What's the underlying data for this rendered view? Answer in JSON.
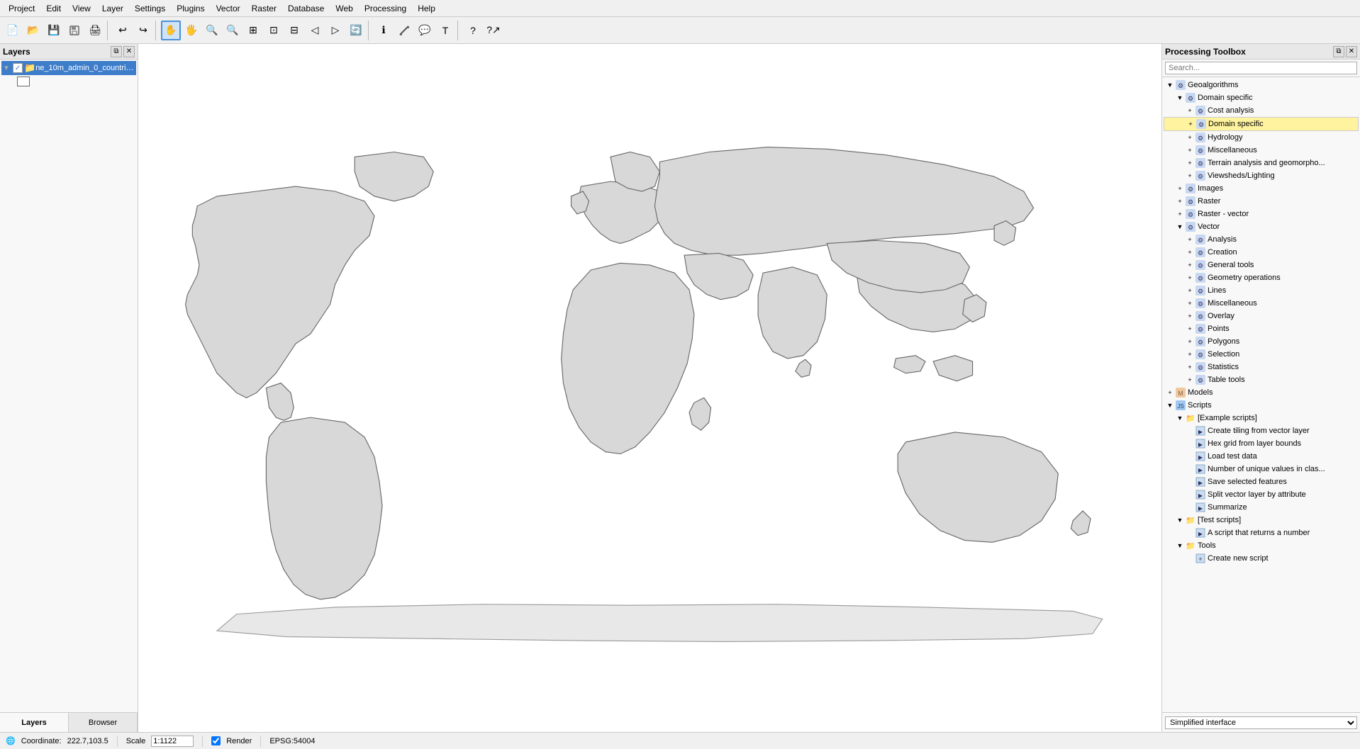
{
  "menubar": {
    "items": [
      "Project",
      "Edit",
      "View",
      "Layer",
      "Settings",
      "Plugins",
      "Vector",
      "Raster",
      "Database",
      "Web",
      "Processing",
      "Help"
    ]
  },
  "toolbar": {
    "buttons": [
      {
        "name": "new",
        "icon": "📄"
      },
      {
        "name": "open",
        "icon": "📂"
      },
      {
        "name": "save",
        "icon": "💾"
      },
      {
        "name": "save-as",
        "icon": "💾"
      },
      {
        "name": "print",
        "icon": "🖨"
      },
      {
        "name": "print-composer",
        "icon": "📋"
      },
      {
        "name": "undo",
        "icon": "↩"
      },
      {
        "name": "redo",
        "icon": "↪"
      },
      {
        "name": "pan",
        "icon": "✋"
      },
      {
        "name": "pan-map",
        "icon": "🖐"
      },
      {
        "name": "zoom-in",
        "icon": "+"
      },
      {
        "name": "zoom-out",
        "icon": "-"
      },
      {
        "name": "zoom-full",
        "icon": "⊞"
      },
      {
        "name": "zoom-layer",
        "icon": "⊡"
      },
      {
        "name": "zoom-selection",
        "icon": "⊟"
      },
      {
        "name": "zoom-last",
        "icon": "◁"
      },
      {
        "name": "zoom-next",
        "icon": "▷"
      },
      {
        "name": "refresh",
        "icon": "🔄"
      },
      {
        "name": "identify",
        "icon": "ℹ"
      },
      {
        "name": "measure",
        "icon": "📏"
      },
      {
        "name": "measure-area",
        "icon": "□"
      },
      {
        "name": "measure-angle",
        "icon": "∠"
      },
      {
        "name": "annotation",
        "icon": "💬"
      },
      {
        "name": "html-annotation",
        "icon": "⊕"
      },
      {
        "name": "svg-annotation",
        "icon": "⊗"
      },
      {
        "name": "text-annotation",
        "icon": "T"
      },
      {
        "name": "move-label",
        "icon": "A↗"
      },
      {
        "name": "help",
        "icon": "?"
      },
      {
        "name": "whats-this",
        "icon": "?↗"
      }
    ]
  },
  "left_panel": {
    "title": "Layers",
    "layers": [
      {
        "name": "ne_10m_admin_0_countric...",
        "checked": true,
        "selected": true,
        "has_sub": true
      }
    ],
    "tabs": [
      "Layers",
      "Browser"
    ]
  },
  "processing_toolbox": {
    "title": "Processing Toolbox",
    "search_placeholder": "Search...",
    "tree": {
      "geoalgorithms": {
        "label": "Geoalgorithms",
        "expanded": true,
        "children": {
          "domain_specific": {
            "label": "Domain specific",
            "expanded": true,
            "children": {
              "cost_analysis": {
                "label": "Cost analysis"
              },
              "domain_specific_tooltip": {
                "label": "Domain specific",
                "tooltip": true
              },
              "hydrology": {
                "label": "Hydrology"
              },
              "miscellaneous": {
                "label": "Miscellaneous"
              },
              "terrain_analysis": {
                "label": "Terrain analysis and geomorpho..."
              },
              "viewsheds_lighting": {
                "label": "Viewsheds/Lighting"
              }
            }
          },
          "images": {
            "label": "Images"
          },
          "raster": {
            "label": "Raster"
          },
          "raster_vector": {
            "label": "Raster - vector"
          },
          "vector": {
            "label": "Vector",
            "expanded": true,
            "children": {
              "analysis": {
                "label": "Analysis"
              },
              "creation": {
                "label": "Creation"
              },
              "general_tools": {
                "label": "General tools"
              },
              "geometry_operations": {
                "label": "Geometry operations"
              },
              "lines": {
                "label": "Lines"
              },
              "miscellaneous": {
                "label": "Miscellaneous"
              },
              "overlay": {
                "label": "Overlay"
              },
              "points": {
                "label": "Points"
              },
              "polygons": {
                "label": "Polygons"
              },
              "selection": {
                "label": "Selection"
              },
              "statistics": {
                "label": "Statistics"
              },
              "table_tools": {
                "label": "Table tools"
              }
            }
          }
        }
      },
      "models": {
        "label": "Models"
      },
      "scripts": {
        "label": "Scripts",
        "expanded": true,
        "children": {
          "example_scripts": {
            "label": "[Example scripts]",
            "expanded": true,
            "children": {
              "create_tiling": {
                "label": "Create tiling from vector layer"
              },
              "hex_grid": {
                "label": "Hex grid from layer bounds"
              },
              "load_test_data": {
                "label": "Load test data"
              },
              "number_unique_values": {
                "label": "Number of unique values in clas..."
              },
              "save_selected": {
                "label": "Save selected features"
              },
              "split_vector": {
                "label": "Split vector layer by attribute"
              },
              "summarize": {
                "label": "Summarize"
              }
            }
          },
          "test_scripts": {
            "label": "[Test scripts]",
            "expanded": true,
            "children": {
              "a_script": {
                "label": "A script that returns a number"
              }
            }
          },
          "tools": {
            "label": "Tools",
            "expanded": false,
            "children": {
              "create_new_script": {
                "label": "Create new script"
              }
            }
          }
        }
      }
    },
    "tooltip_text": "Domain specific",
    "simplified_interface": "Simplified interface"
  },
  "statusbar": {
    "coordinate_label": "Coordinate:",
    "coordinate_value": "222.7,103.5",
    "scale_label": "Scale",
    "scale_value": "1:1122",
    "render_label": "Render",
    "render_checked": true,
    "epsg_label": "EPSG:54004",
    "globe_icon": "🌐"
  }
}
